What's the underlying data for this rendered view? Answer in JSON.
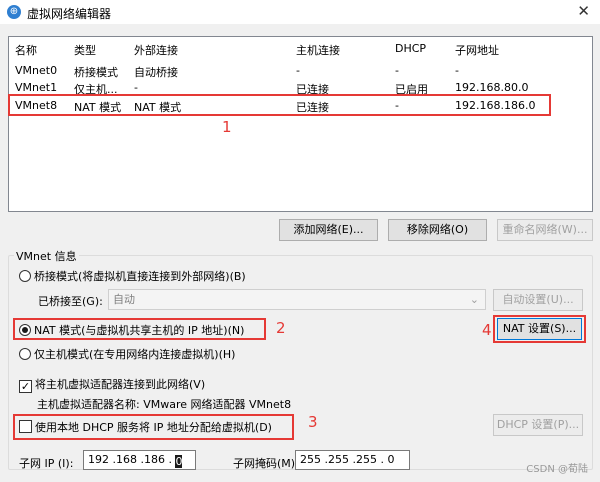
{
  "window": {
    "title": "虚拟网络编辑器",
    "close": "✕"
  },
  "table": {
    "headers": [
      "名称",
      "类型",
      "外部连接",
      "主机连接",
      "DHCP",
      "子网地址"
    ],
    "rows": [
      [
        "VMnet0",
        "桥接模式",
        "自动桥接",
        "-",
        "-",
        "-"
      ],
      [
        "VMnet1",
        "仅主机...",
        "-",
        "已连接",
        "已启用",
        "192.168.80.0"
      ],
      [
        "VMnet8",
        "NAT 模式",
        "NAT 模式",
        "已连接",
        "-",
        "192.168.186.0"
      ]
    ]
  },
  "buttons": {
    "add": "添加网络(E)...",
    "remove": "移除网络(O)",
    "rename": "重命名网络(W)..."
  },
  "vmnet_info": {
    "title": "VMnet 信息",
    "bridge_mode": "桥接模式(将虚拟机直接连接到外部网络)(B)",
    "bridged_to_label": "已桥接至(G):",
    "bridged_to_value": "自动",
    "auto_settings": "自动设置(U)...",
    "nat_mode": "NAT 模式(与虚拟机共享主机的 IP 地址)(N)",
    "nat_settings": "NAT 设置(S)...",
    "host_only": "仅主机模式(在专用网络内连接虚拟机)(H)",
    "connect_adapter": "将主机虚拟适配器连接到此网络(V)",
    "adapter_name": "主机虚拟适配器名称: VMware 网络适配器 VMnet8",
    "use_dhcp": "使用本地 DHCP 服务将 IP 地址分配给虚拟机(D)",
    "dhcp_settings": "DHCP 设置(P)...",
    "subnet_ip_label": "子网 IP (I):",
    "subnet_ip_value": "192 .168 .186 . ",
    "subnet_ip_last": "0",
    "subnet_mask_label": "子网掩码(M):",
    "subnet_mask_value": "255 .255 .255 . 0"
  },
  "annotations": [
    "1",
    "2",
    "3",
    "4"
  ],
  "watermark": "CSDN @荀陆",
  "colors": {
    "annotation": "#e53935",
    "accent": "#0078d7"
  }
}
